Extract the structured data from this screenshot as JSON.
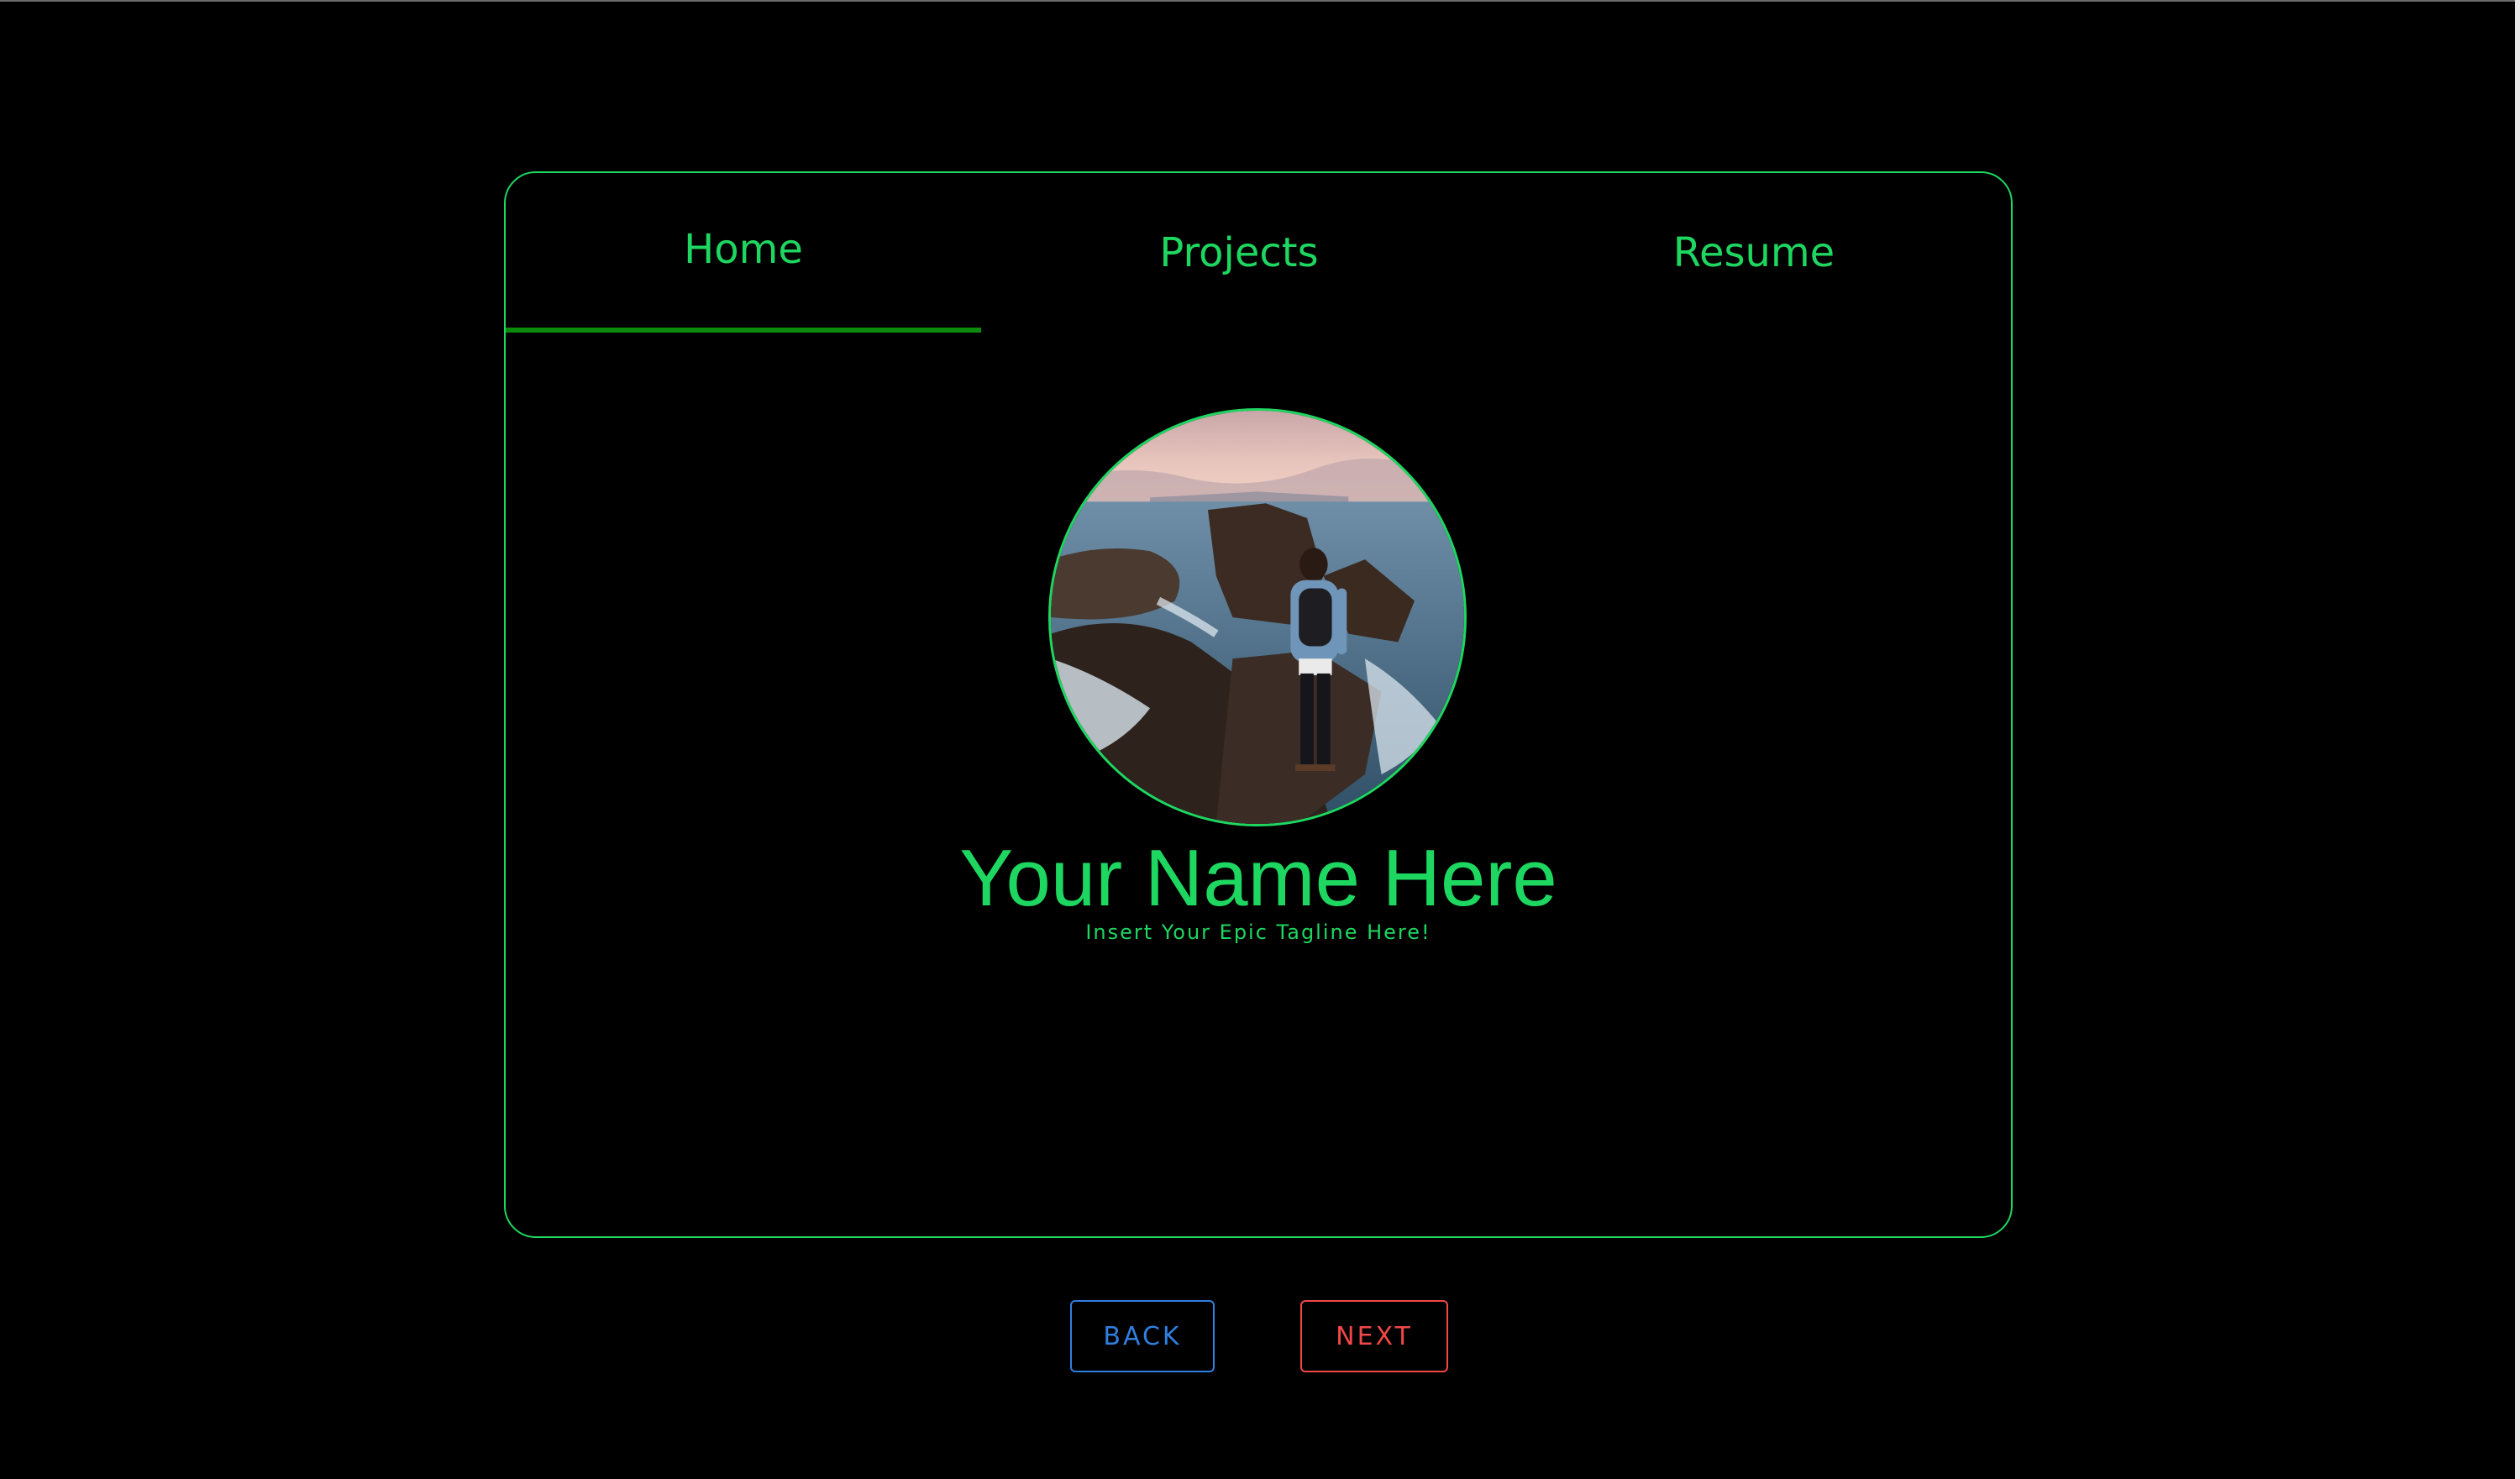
{
  "nav": {
    "tabs": [
      {
        "label": "Home",
        "active": true
      },
      {
        "label": "Projects",
        "active": false
      },
      {
        "label": "Resume",
        "active": false
      }
    ]
  },
  "profile": {
    "name": "Your Name Here",
    "tagline": "Insert Your Epic Tagline Here!",
    "avatar_icon": "profile-photo"
  },
  "buttons": {
    "back_label": "BACK",
    "next_label": "NEXT"
  },
  "colors": {
    "accent": "#1ed760",
    "tab_indicator": "#0c8b0c",
    "back": "#2f7fe0",
    "next": "#f04848",
    "background": "#000000"
  }
}
